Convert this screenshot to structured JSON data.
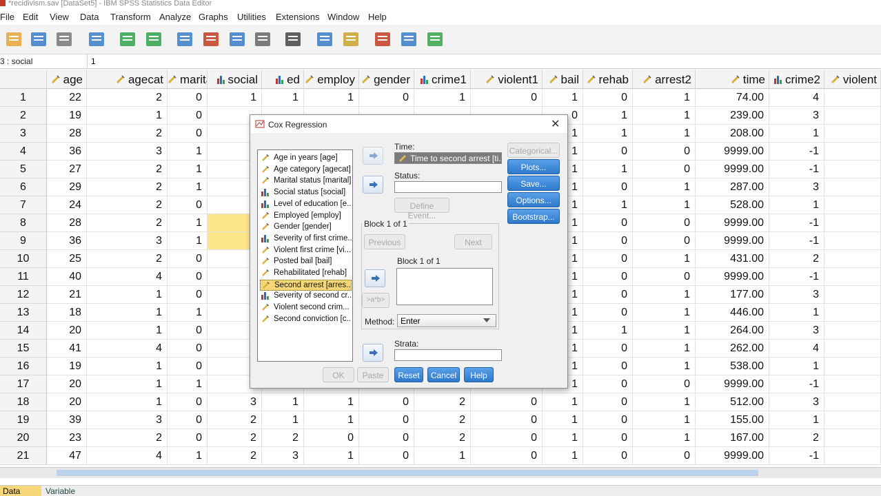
{
  "window": {
    "title": "*recidivism.sav [DataSet5] - IBM SPSS Statistics Data Editor"
  },
  "menu": [
    "File",
    "Edit",
    "View",
    "Data",
    "Transform",
    "Analyze",
    "Graphs",
    "Utilities",
    "Extensions",
    "Window",
    "Help"
  ],
  "toolbar_icons": [
    "open-icon",
    "save-icon",
    "print-icon",
    "dialog-recall-icon",
    "undo-icon",
    "redo-icon",
    "goto-case-icon",
    "goto-variable-icon",
    "variables-icon",
    "run-descriptives-icon",
    "find-icon",
    "split-file-icon",
    "select-cases-icon",
    "value-labels-icon",
    "use-sets-icon",
    "spelling-icon"
  ],
  "cell_ref": {
    "name": "3 : social",
    "value": "1"
  },
  "columns": [
    {
      "name": "age",
      "type": "scale"
    },
    {
      "name": "agecat",
      "type": "scale"
    },
    {
      "name": "marital",
      "type": "scale"
    },
    {
      "name": "social",
      "type": "nominal"
    },
    {
      "name": "ed",
      "type": "nominal"
    },
    {
      "name": "employ",
      "type": "scale"
    },
    {
      "name": "gender",
      "type": "scale"
    },
    {
      "name": "crime1",
      "type": "nominal"
    },
    {
      "name": "violent1",
      "type": "scale"
    },
    {
      "name": "bail",
      "type": "scale"
    },
    {
      "name": "rehab",
      "type": "scale"
    },
    {
      "name": "arrest2",
      "type": "scale"
    },
    {
      "name": "time",
      "type": "scale"
    },
    {
      "name": "crime2",
      "type": "nominal"
    },
    {
      "name": "violent",
      "type": "scale"
    }
  ],
  "rows": [
    {
      "n": "1",
      "c": [
        "22",
        "2",
        "0",
        "1",
        "1",
        "1",
        "0",
        "1",
        "0",
        "1",
        "0",
        "1",
        "74.00",
        "4",
        ""
      ]
    },
    {
      "n": "2",
      "c": [
        "19",
        "1",
        "0",
        "",
        "",
        "",
        "",
        "",
        "",
        "0",
        "1",
        "1",
        "239.00",
        "3",
        ""
      ]
    },
    {
      "n": "3",
      "c": [
        "28",
        "2",
        "0",
        "",
        "",
        "",
        "",
        "",
        "",
        "1",
        "1",
        "1",
        "208.00",
        "1",
        ""
      ]
    },
    {
      "n": "4",
      "c": [
        "36",
        "3",
        "1",
        "",
        "",
        "",
        "",
        "",
        "",
        "1",
        "0",
        "0",
        "9999.00",
        "-1",
        ""
      ]
    },
    {
      "n": "5",
      "c": [
        "27",
        "2",
        "1",
        "",
        "",
        "",
        "",
        "",
        "",
        "1",
        "1",
        "0",
        "9999.00",
        "-1",
        ""
      ]
    },
    {
      "n": "6",
      "c": [
        "29",
        "2",
        "1",
        "",
        "",
        "",
        "",
        "",
        "",
        "1",
        "0",
        "1",
        "287.00",
        "3",
        ""
      ]
    },
    {
      "n": "7",
      "c": [
        "24",
        "2",
        "0",
        "",
        "",
        "",
        "",
        "",
        "",
        "1",
        "1",
        "1",
        "528.00",
        "1",
        ""
      ]
    },
    {
      "n": "8",
      "c": [
        "28",
        "2",
        "1",
        "",
        "",
        "",
        "",
        "",
        "",
        "1",
        "0",
        "0",
        "9999.00",
        "-1",
        ""
      ]
    },
    {
      "n": "9",
      "c": [
        "36",
        "3",
        "1",
        "",
        "",
        "",
        "",
        "",
        "",
        "1",
        "0",
        "0",
        "9999.00",
        "-1",
        ""
      ]
    },
    {
      "n": "10",
      "c": [
        "25",
        "2",
        "0",
        "",
        "",
        "",
        "",
        "",
        "",
        "1",
        "0",
        "1",
        "431.00",
        "2",
        ""
      ]
    },
    {
      "n": "11",
      "c": [
        "40",
        "4",
        "0",
        "",
        "",
        "",
        "",
        "",
        "",
        "1",
        "0",
        "0",
        "9999.00",
        "-1",
        ""
      ]
    },
    {
      "n": "12",
      "c": [
        "21",
        "1",
        "0",
        "",
        "",
        "",
        "",
        "",
        "",
        "1",
        "0",
        "1",
        "177.00",
        "3",
        ""
      ]
    },
    {
      "n": "13",
      "c": [
        "18",
        "1",
        "1",
        "",
        "",
        "",
        "",
        "",
        "",
        "1",
        "0",
        "1",
        "446.00",
        "1",
        ""
      ]
    },
    {
      "n": "14",
      "c": [
        "20",
        "1",
        "0",
        "",
        "",
        "",
        "",
        "",
        "",
        "1",
        "1",
        "1",
        "264.00",
        "3",
        ""
      ]
    },
    {
      "n": "15",
      "c": [
        "41",
        "4",
        "0",
        "",
        "",
        "",
        "",
        "",
        "",
        "1",
        "0",
        "1",
        "262.00",
        "4",
        ""
      ]
    },
    {
      "n": "16",
      "c": [
        "19",
        "1",
        "0",
        "",
        "",
        "",
        "",
        "",
        "",
        "1",
        "0",
        "1",
        "538.00",
        "1",
        ""
      ]
    },
    {
      "n": "17",
      "c": [
        "20",
        "1",
        "1",
        "",
        "",
        "",
        "",
        "",
        "",
        "1",
        "0",
        "0",
        "9999.00",
        "-1",
        ""
      ]
    },
    {
      "n": "18",
      "c": [
        "20",
        "1",
        "0",
        "3",
        "1",
        "1",
        "0",
        "2",
        "0",
        "1",
        "0",
        "1",
        "512.00",
        "3",
        ""
      ]
    },
    {
      "n": "19",
      "c": [
        "39",
        "3",
        "0",
        "2",
        "1",
        "1",
        "0",
        "2",
        "0",
        "1",
        "0",
        "1",
        "155.00",
        "1",
        ""
      ]
    },
    {
      "n": "20",
      "c": [
        "23",
        "2",
        "0",
        "2",
        "2",
        "0",
        "0",
        "2",
        "0",
        "1",
        "0",
        "1",
        "167.00",
        "2",
        ""
      ]
    },
    {
      "n": "21",
      "c": [
        "47",
        "4",
        "1",
        "2",
        "3",
        "1",
        "0",
        "1",
        "0",
        "1",
        "0",
        "0",
        "9999.00",
        "-1",
        ""
      ]
    }
  ],
  "tabs": {
    "data_view": "Data View",
    "variable_view": "Variable View"
  },
  "dialog": {
    "title": "Cox Regression",
    "variables": [
      {
        "label": "Age in years [age]",
        "type": "scale"
      },
      {
        "label": "Age category [agecat]",
        "type": "scale"
      },
      {
        "label": "Marital status [marital]",
        "type": "scale"
      },
      {
        "label": "Social status [social]",
        "type": "nominal"
      },
      {
        "label": "Level of education [e...",
        "type": "nominal"
      },
      {
        "label": "Employed [employ]",
        "type": "scale"
      },
      {
        "label": "Gender [gender]",
        "type": "scale"
      },
      {
        "label": "Severity of first crime...",
        "type": "nominal"
      },
      {
        "label": "Violent first crime [vi...",
        "type": "scale"
      },
      {
        "label": "Posted bail [bail]",
        "type": "scale"
      },
      {
        "label": "Rehabilitated [rehab]",
        "type": "scale"
      },
      {
        "label": "Second arrest [arres...",
        "type": "scale",
        "selected": true
      },
      {
        "label": "Severity of second cr...",
        "type": "nominal"
      },
      {
        "label": "Violent second crim...",
        "type": "scale"
      },
      {
        "label": "Second conviction [c...",
        "type": "scale"
      }
    ],
    "time_label": "Time:",
    "time_value": "Time to second arrest [ti...",
    "status_label": "Status:",
    "define_event": "Define Event...",
    "block_header": "Block 1 of 1",
    "previous": "Previous",
    "next": "Next",
    "block_inner": "Block 1 of 1",
    "interaction": ">a*b>",
    "method_label": "Method:",
    "method_value": "Enter",
    "strata_label": "Strata:",
    "side_buttons": {
      "categorical": "Categorical...",
      "plots": "Plots...",
      "save": "Save...",
      "options": "Options...",
      "bootstrap": "Bootstrap..."
    },
    "bottom_buttons": {
      "ok": "OK",
      "paste": "Paste",
      "reset": "Reset",
      "cancel": "Cancel",
      "help": "Help"
    }
  },
  "colors": {
    "highlight": "#fde58a",
    "selected_var": "#f5d77a",
    "blue_button": "#2e79cc"
  }
}
